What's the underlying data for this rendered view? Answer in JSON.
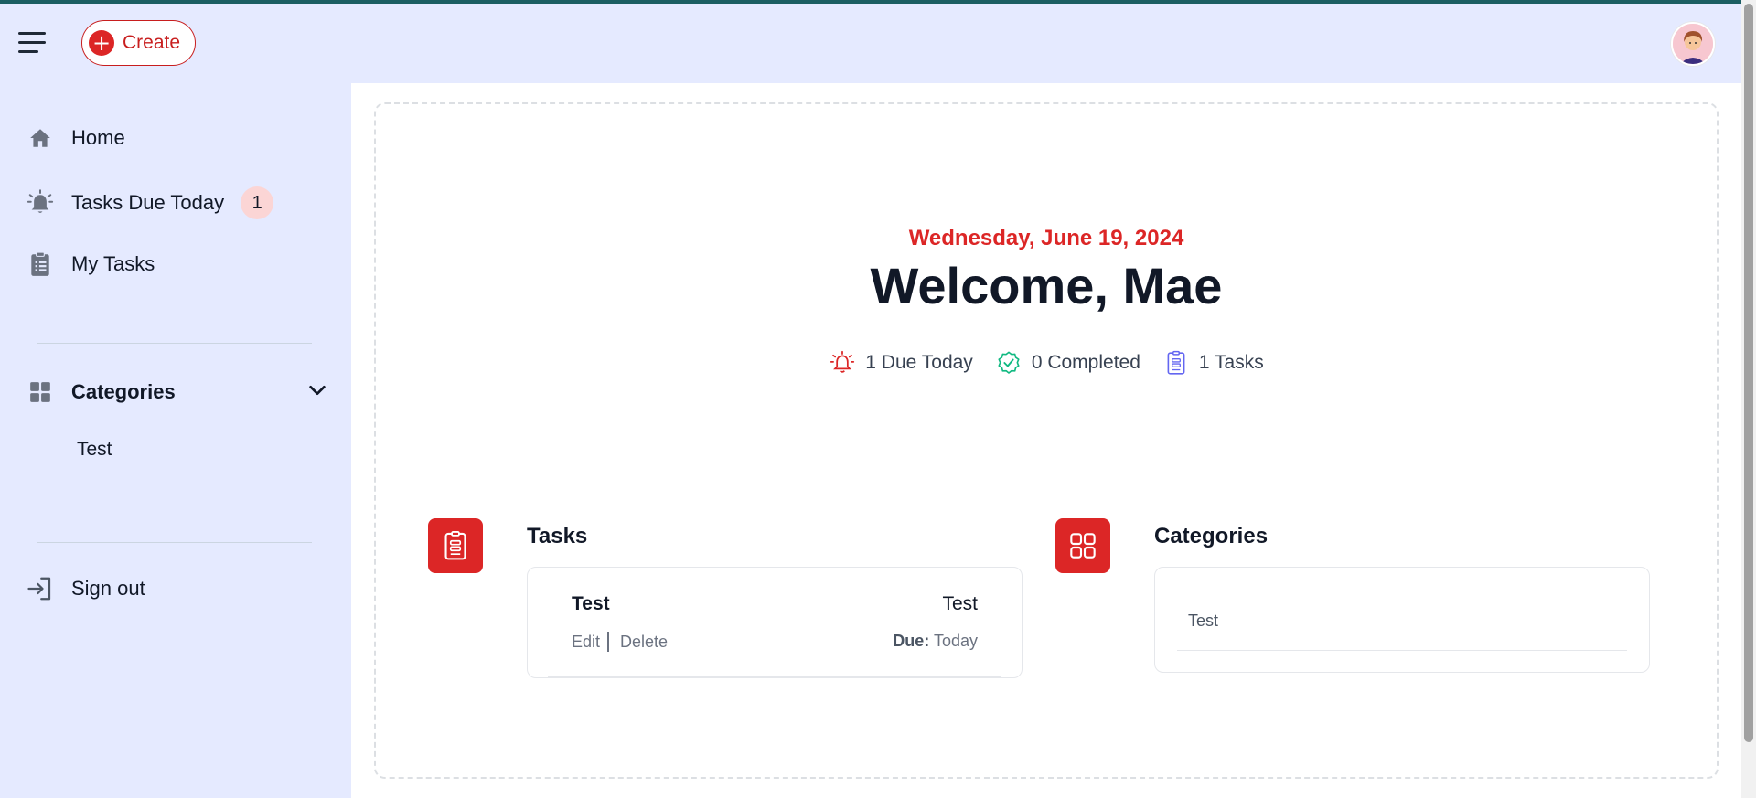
{
  "header": {
    "create_label": "Create",
    "avatar_icon": "user-avatar-icon",
    "menu_icon": "hamburger-menu-icon"
  },
  "sidebar": {
    "items": [
      {
        "label": "Home",
        "icon": "home-icon"
      },
      {
        "label": "Tasks Due Today",
        "icon": "alarm-bell-icon",
        "badge": "1"
      },
      {
        "label": "My Tasks",
        "icon": "clipboard-icon"
      }
    ],
    "categories": {
      "label": "Categories",
      "icon": "grid-icon",
      "expanded": true,
      "items": [
        "Test"
      ]
    },
    "sign_out": {
      "label": "Sign out",
      "icon": "sign-out-icon"
    }
  },
  "main": {
    "date": "Wednesday, June 19, 2024",
    "welcome": "Welcome, Mae",
    "stats": [
      {
        "text": "1 Due Today",
        "icon": "alarm-icon",
        "color": "#dc2626"
      },
      {
        "text": "0 Completed",
        "icon": "check-badge-icon",
        "color": "#10b981"
      },
      {
        "text": "1 Tasks",
        "icon": "clipboard-list-icon",
        "color": "#6366f1"
      }
    ],
    "tasks_section": {
      "title": "Tasks",
      "tasks": [
        {
          "name": "Test",
          "category": "Test",
          "edit": "Edit",
          "delete": "Delete",
          "due_label": "Due:",
          "due_value": "Today"
        }
      ]
    },
    "categories_section": {
      "title": "Categories",
      "items": [
        "Test"
      ]
    }
  },
  "colors": {
    "accent": "#dc2626",
    "sidebar_bg": "#e5eaff",
    "text": "#111827"
  }
}
